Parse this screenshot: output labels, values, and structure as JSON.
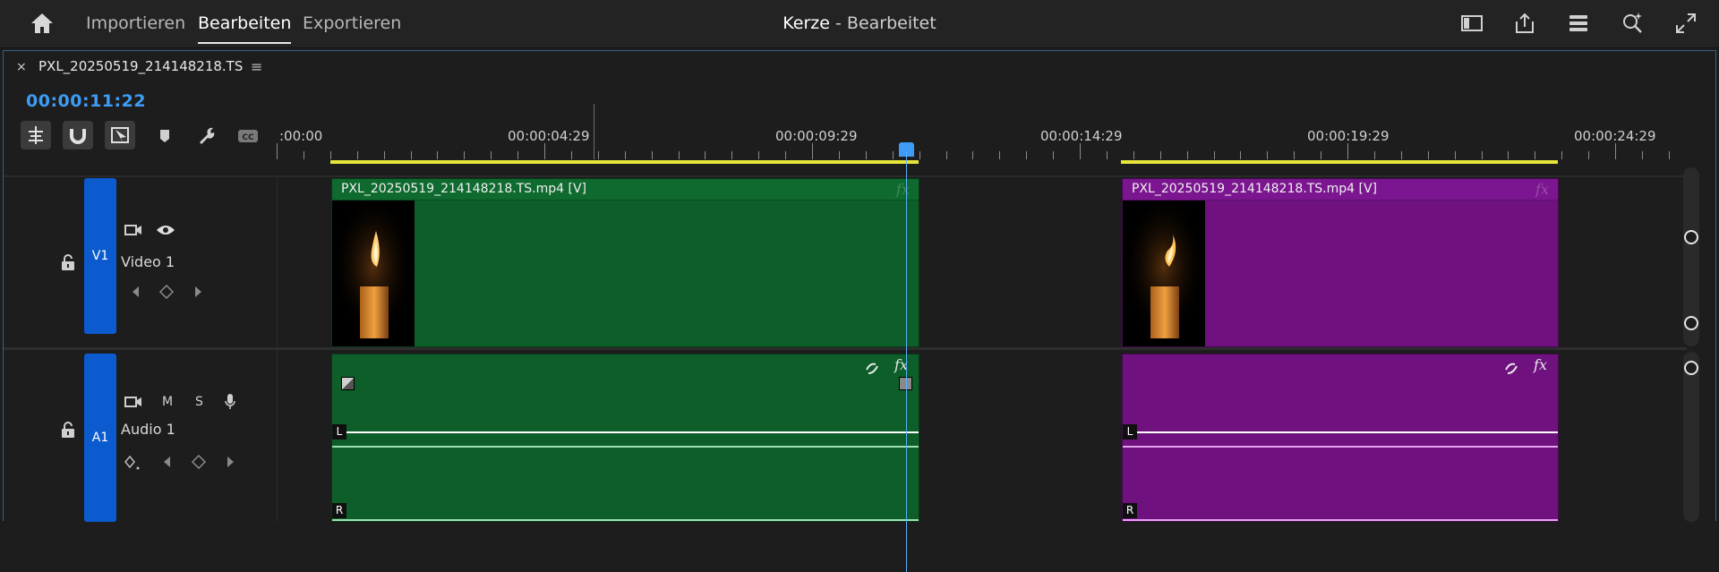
{
  "topbar": {
    "nav": [
      "Importieren",
      "Bearbeiten",
      "Exportieren"
    ],
    "active": "Bearbeiten",
    "project_name": "Kerze",
    "project_status": " - Bearbeitet"
  },
  "sequence_tab": {
    "name": "PXL_20250519_214148218.TS",
    "close_glyph": "×",
    "menu_glyph": "≡"
  },
  "timecode": "00:00:11:22",
  "ruler": {
    "labels": [
      ":00:00",
      "00:00:04:29",
      "00:00:09:29",
      "00:00:14:29",
      "00:00:19:29",
      "00:00:24:29"
    ]
  },
  "tracks": {
    "video": {
      "tag": "V1",
      "name": "Video 1"
    },
    "audio": {
      "tag": "A1",
      "name": "Audio 1",
      "mute": "M",
      "solo": "S"
    }
  },
  "clips": {
    "video1": {
      "label": "PXL_20250519_214148218.TS.mp4 [V]",
      "fx": "fx"
    },
    "video2": {
      "label": "PXL_20250519_214148218.TS.mp4 [V]",
      "fx": "fx"
    },
    "audio1": {
      "fx": "fx",
      "left": "L",
      "right": "R"
    },
    "audio2": {
      "fx": "fx",
      "left": "L",
      "right": "R"
    }
  },
  "colors": {
    "accent": "#3e9cf5",
    "track_tag": "#0b5bcf",
    "clip_green": "#0d5e29",
    "clip_purple": "#6f1280",
    "work_area": "#e6e63a"
  },
  "icons": [
    "home-icon",
    "panel-layout-icon",
    "share-icon",
    "list-icon",
    "zoom-icon",
    "fullscreen-icon"
  ]
}
